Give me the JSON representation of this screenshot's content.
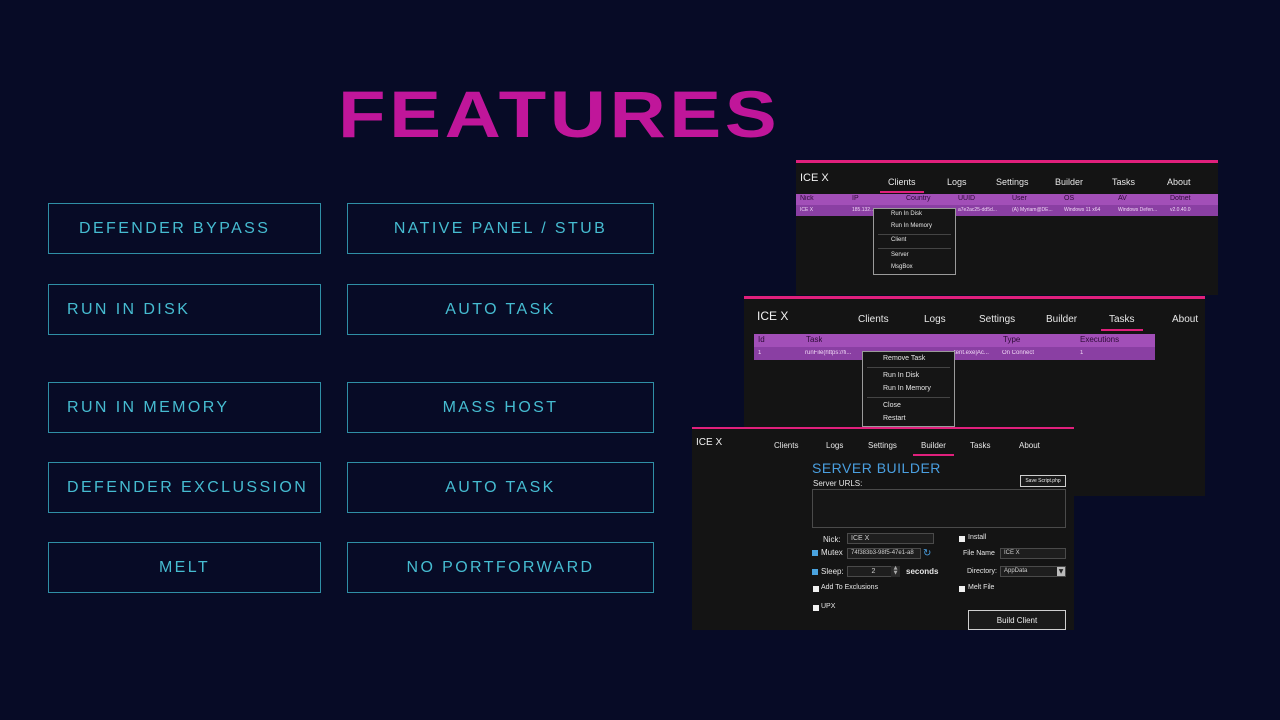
{
  "title": "FEATURES",
  "features": {
    "left": [
      "DEFENDER BYPASS",
      "RUN IN DISK",
      "RUN IN MEMORY",
      "DEFENDER EXCLUSSION",
      "MELT"
    ],
    "right": [
      "NATIVE PANEL / STUB",
      "AUTO TASK",
      "MASS HOST",
      "AUTO TASK",
      "NO PORTFORWARD"
    ]
  },
  "app": {
    "name": "ICE X"
  },
  "nav": [
    "Clients",
    "Logs",
    "Settings",
    "Builder",
    "Tasks",
    "About"
  ],
  "clients": {
    "columns": [
      "Nick",
      "IP",
      "Country",
      "UUID",
      "User",
      "OS",
      "AV",
      "Dotnet"
    ],
    "row": [
      "ICE X",
      "185.132...",
      "",
      "a7e2ac25-dd5d...",
      "(A) Myriam@DE...",
      "Windows 11 x64",
      "Windows Defen...",
      "v2.0.40.0"
    ],
    "menu": [
      "Run In Disk",
      "Run In Memory",
      "Client",
      "Server",
      "MsgBox"
    ]
  },
  "tasks": {
    "columns": [
      "Id",
      "Task",
      "Type",
      "Executions"
    ],
    "row": [
      "1",
      "runFile(https://fi...",
      "tent.exe|Ac...",
      "On Connect",
      "1"
    ],
    "menu": [
      "Remove Task",
      "Run In Disk",
      "Run In Memory",
      "Close",
      "Restart"
    ]
  },
  "builder": {
    "heading": "SERVER BUILDER",
    "server_urls_label": "Server URLS:",
    "save_button": "Save Script.php",
    "nick_label": "Nick:",
    "nick_value": "ICE X",
    "mutex_label": "Mutex",
    "mutex_value": "74f383b3-98f5-47e1-a8",
    "sleep_label": "Sleep:",
    "sleep_value": "2",
    "seconds_label": "seconds",
    "exclusions_label": "Add To Exclusions",
    "upx_label": "UPX",
    "install_label": "Install",
    "filename_label": "File Name",
    "filename_value": "ICE X",
    "directory_label": "Directory:",
    "directory_value": "AppData",
    "melt_label": "Melt File",
    "build_button": "Build Client"
  },
  "colors": {
    "accent": "#c0169a",
    "cyan": "#46bcd1",
    "table": "#a24fb8"
  }
}
